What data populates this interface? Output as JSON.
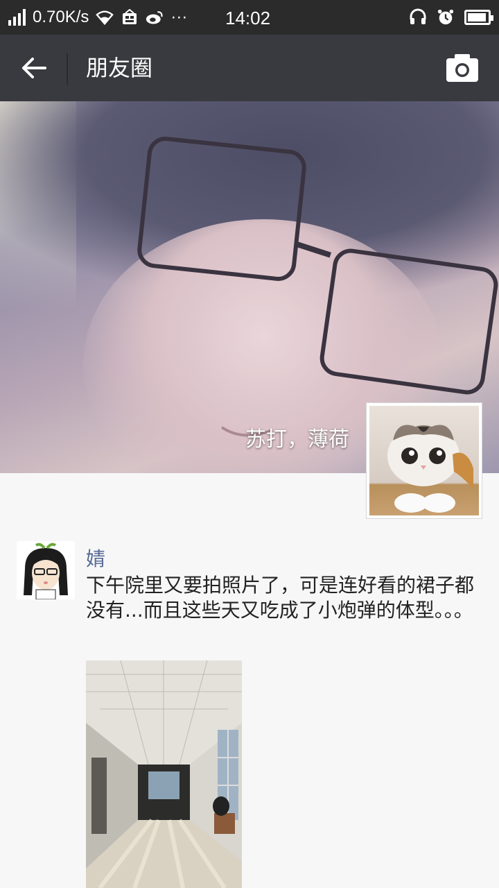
{
  "status_bar": {
    "speed": "0.70K/s",
    "time": "14:02",
    "icons": [
      "signal-icon",
      "wifi-icon",
      "store-icon",
      "weibo-icon",
      "more-icon",
      "headset-icon",
      "alarm-icon",
      "battery-icon"
    ],
    "more": "···"
  },
  "header": {
    "title": "朋友圈",
    "back_icon": "arrow-left-icon",
    "camera_icon": "camera-icon"
  },
  "cover": {
    "nickname": "苏打，薄荷"
  },
  "post": {
    "username": "婧",
    "text": "下午院里又要拍照片了，可是连好看的裙子都没有...而且这些天又吃成了小炮弹的体型。。。"
  },
  "colors": {
    "status_bar_bg": "#2b2b2b",
    "title_bar_bg": "#393a3f",
    "username_color": "#576b95",
    "page_bg": "#f7f7f7"
  }
}
